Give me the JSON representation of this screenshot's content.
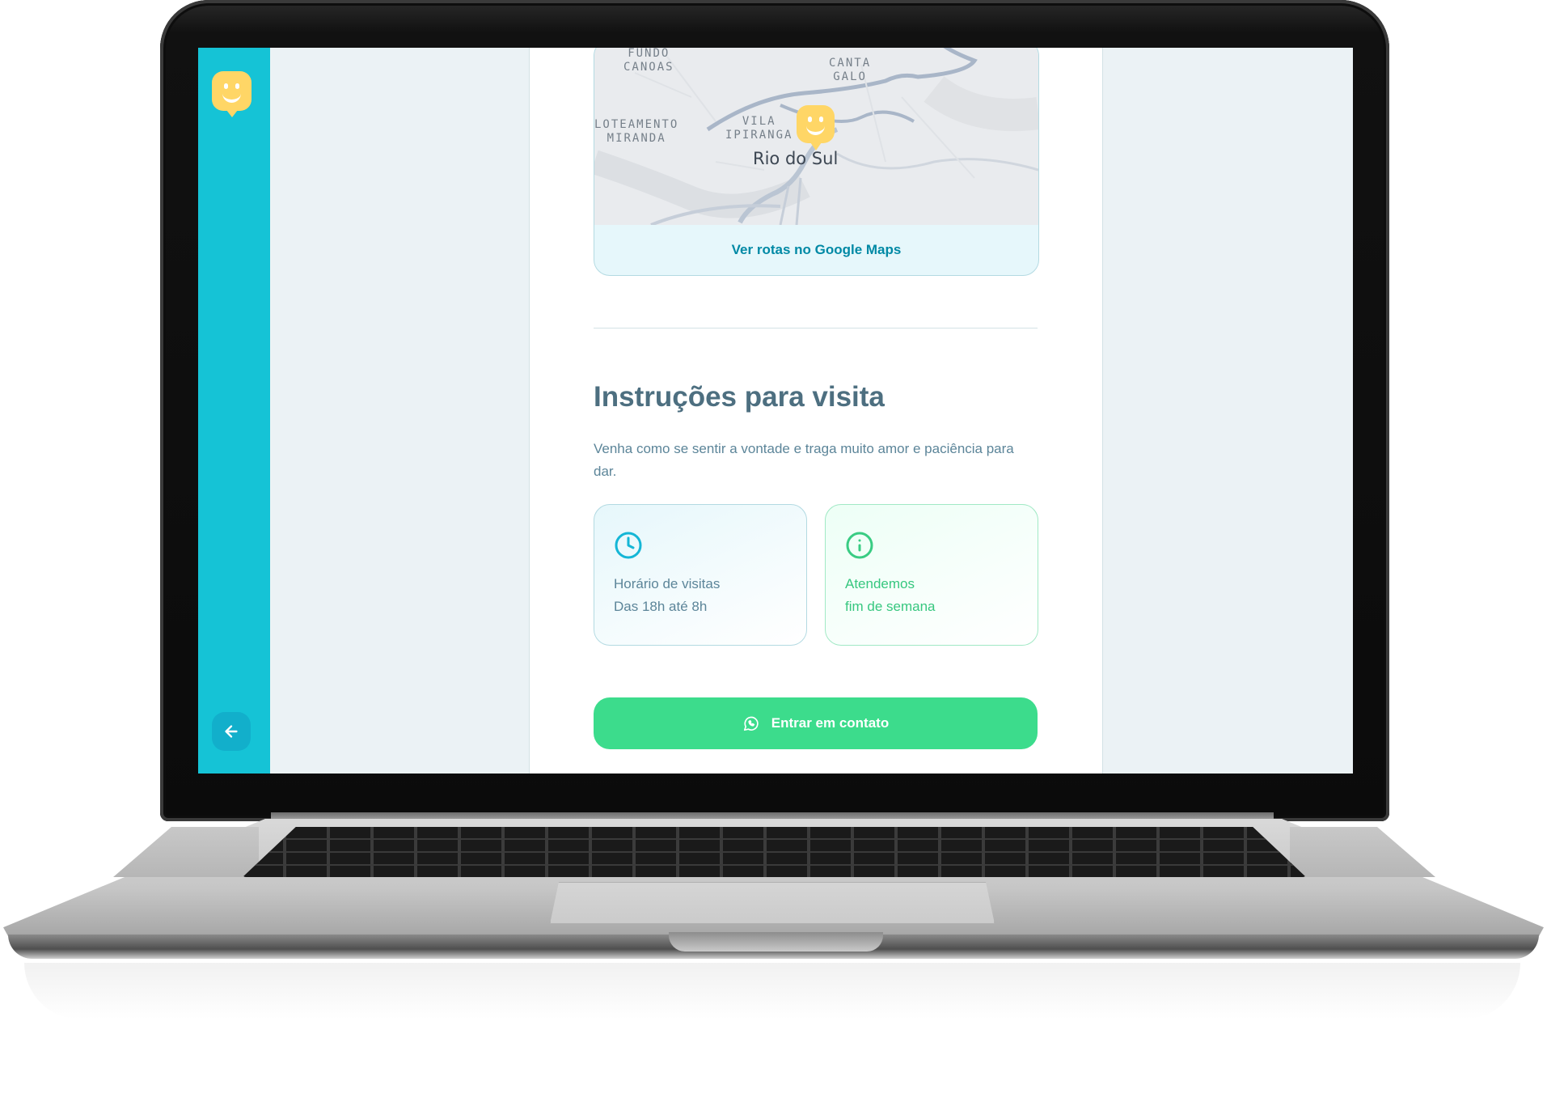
{
  "map": {
    "city": "Rio do Sul",
    "labels": {
      "fundo_canoas": "FUNDO\nCANOAS",
      "canta_galo": "CANTA\nGALO",
      "loteamento": "LOTEAMENTO\nMIRANDA",
      "vila": "VILA\nIPIRANGA"
    },
    "route_link": "Ver rotas no Google Maps"
  },
  "instructions": {
    "title": "Instruções para visita",
    "description": "Venha como se sentir a vontade e traga muito amor e paciência para dar."
  },
  "cards": {
    "hours_line1": "Horário de visitas",
    "hours_line2": "Das 18h até 8h",
    "weekend_line1": "Atendemos",
    "weekend_line2": "fim de semana"
  },
  "contact_button": "Entrar em contato",
  "icons": {
    "logo": "smile-logo-icon",
    "back": "arrow-left-icon",
    "hours": "clock-icon",
    "weekend": "info-icon",
    "contact": "whatsapp-icon",
    "pin": "map-pin-icon"
  },
  "colors": {
    "sidebar": "#15c3d6",
    "logo": "#ffd666",
    "title": "#4d6f80",
    "text": "#5c8599",
    "link": "#0089a5",
    "green": "#37c77f",
    "button": "#3cdc8c"
  }
}
